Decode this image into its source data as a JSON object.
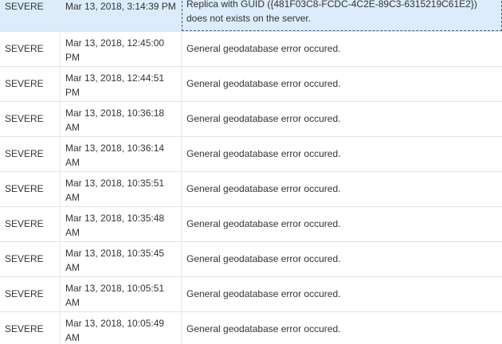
{
  "log_rows": [
    {
      "level": "SEVERE",
      "time": "Mar 13, 2018, 3:14:39 PM",
      "message": "Replica with GUID ({481F03C8-FCDC-4C2E-89C3-6315219C61E2}) does not exists on the server."
    },
    {
      "level": "SEVERE",
      "time": "Mar 13, 2018, 12:45:00 PM",
      "message": "General geodatabase error occured."
    },
    {
      "level": "SEVERE",
      "time": "Mar 13, 2018, 12:44:51 PM",
      "message": "General geodatabase error occured."
    },
    {
      "level": "SEVERE",
      "time": "Mar 13, 2018, 10:36:18 AM",
      "message": "General geodatabase error occured."
    },
    {
      "level": "SEVERE",
      "time": "Mar 13, 2018, 10:36:14 AM",
      "message": "General geodatabase error occured."
    },
    {
      "level": "SEVERE",
      "time": "Mar 13, 2018, 10:35:51 AM",
      "message": "General geodatabase error occured."
    },
    {
      "level": "SEVERE",
      "time": "Mar 13, 2018, 10:35:48 AM",
      "message": "General geodatabase error occured."
    },
    {
      "level": "SEVERE",
      "time": "Mar 13, 2018, 10:35:45 AM",
      "message": "General geodatabase error occured."
    },
    {
      "level": "SEVERE",
      "time": "Mar 13, 2018, 10:05:51 AM",
      "message": "General geodatabase error occured."
    },
    {
      "level": "SEVERE",
      "time": "Mar 13, 2018, 10:05:49 AM",
      "message": "General geodatabase error occured."
    }
  ]
}
